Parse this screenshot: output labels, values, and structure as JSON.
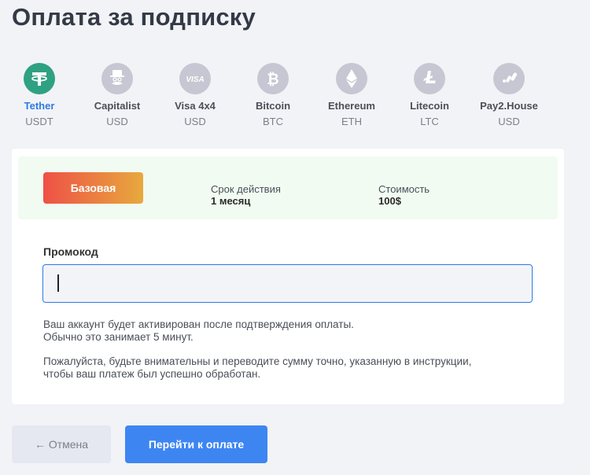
{
  "title": "Оплата за подписку",
  "methods": [
    {
      "name": "Tether",
      "currency": "USDT",
      "icon": "tether-icon",
      "active": true
    },
    {
      "name": "Capitalist",
      "currency": "USD",
      "icon": "capitalist-icon",
      "active": false
    },
    {
      "name": "Visa 4x4",
      "currency": "USD",
      "icon": "visa-icon",
      "active": false
    },
    {
      "name": "Bitcoin",
      "currency": "BTC",
      "icon": "bitcoin-icon",
      "active": false
    },
    {
      "name": "Ethereum",
      "currency": "ETH",
      "icon": "ethereum-icon",
      "active": false
    },
    {
      "name": "Litecoin",
      "currency": "LTC",
      "icon": "litecoin-icon",
      "active": false
    },
    {
      "name": "Pay2.House",
      "currency": "USD",
      "icon": "pay2house-icon",
      "active": false
    }
  ],
  "plan": {
    "badge": "Базовая",
    "term_label": "Срок действия",
    "term_value": "1 месяц",
    "price_label": "Стоимость",
    "price_value": "100$"
  },
  "promo": {
    "label": "Промокод",
    "value": "",
    "placeholder": ""
  },
  "info": {
    "line1": "Ваш аккаунт будет активирован после подтверждения оплаты.",
    "line2": "Обычно это занимает 5 минут.",
    "line3": "Пожалуйста, будьте внимательны и переводите сумму точно, указанную в инструкции,",
    "line4": "чтобы ваш платеж был успешно обработан."
  },
  "buttons": {
    "cancel": "← Отмена",
    "pay": "Перейти к оплате"
  },
  "colors": {
    "active_method": "#2fa182",
    "active_text": "#2c7be5",
    "primary_button": "#3d86f2",
    "badge_gradient_start": "#ee5146",
    "badge_gradient_end": "#e8a93d",
    "plan_background": "#f2fbf1"
  }
}
